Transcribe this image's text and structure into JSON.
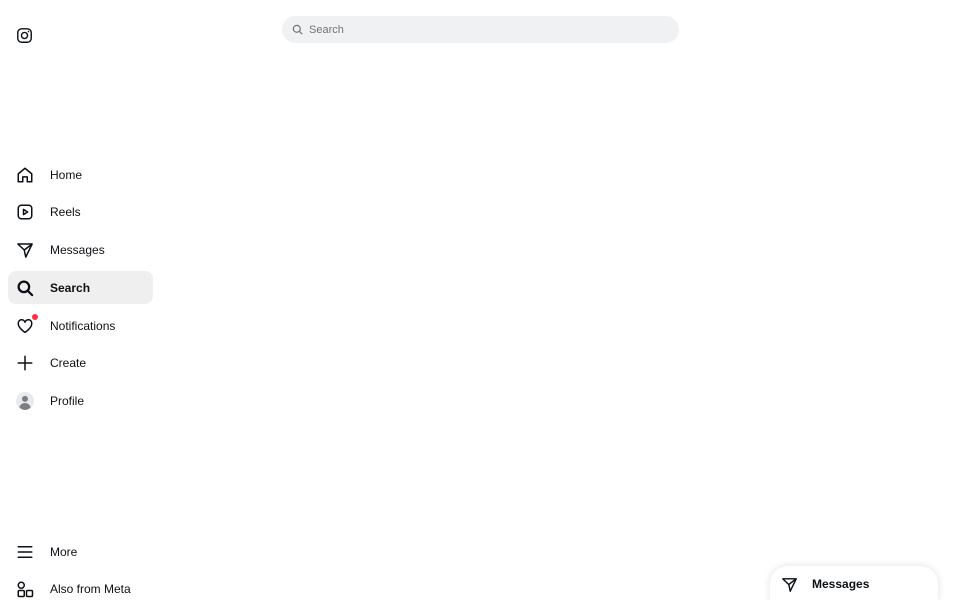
{
  "app": {
    "name": "Instagram",
    "logo_icon": "instagram-logo-icon"
  },
  "search": {
    "placeholder": "Search",
    "icon": "search-icon"
  },
  "sidebar": {
    "items": [
      {
        "label": "Home",
        "icon": "home-icon"
      },
      {
        "label": "Reels",
        "icon": "reels-icon"
      },
      {
        "label": "Messages",
        "icon": "messages-icon"
      },
      {
        "label": "Search",
        "icon": "search-icon",
        "active": true
      },
      {
        "label": "Notifications",
        "icon": "heart-icon",
        "has_badge": true
      },
      {
        "label": "Create",
        "icon": "plus-icon"
      },
      {
        "label": "Profile",
        "icon": "avatar-icon"
      }
    ],
    "bottom_items": [
      {
        "label": "More",
        "icon": "menu-icon"
      },
      {
        "label": "Also from Meta",
        "icon": "apps-icon"
      }
    ]
  },
  "messages_pill": {
    "label": "Messages",
    "icon": "messages-icon"
  },
  "colors": {
    "active_bg": "#efefef",
    "badge": "#ff3040",
    "search_bg": "#f0f1f2",
    "text": "#0c1014"
  }
}
